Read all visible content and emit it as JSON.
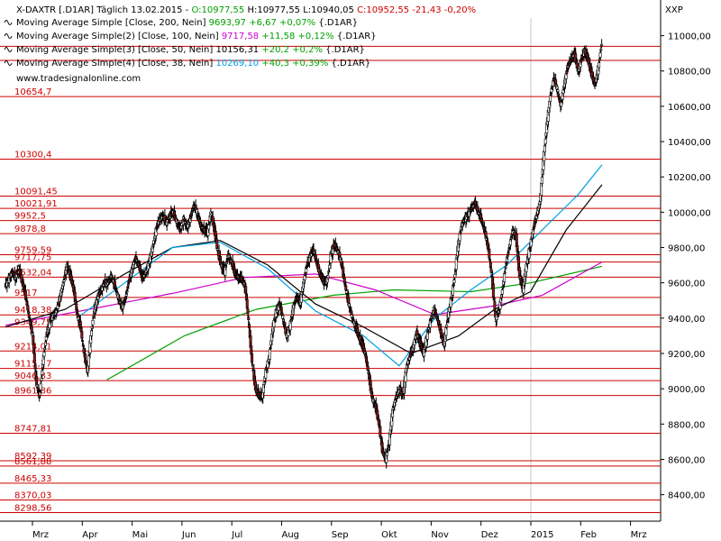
{
  "header": {
    "symbol_line": {
      "prefix": "X-DAXTR [.D1AR] Täglich 13.02.2015 - ",
      "open": "O:10977,55",
      "high": "H:10977,55",
      "low": "L:10940,05",
      "close": "C:10952,55 -21,43 -0,20%"
    },
    "currency": "XXP",
    "watermark": "www.tradesignalonline.com"
  },
  "legend": [
    {
      "label": "Moving Average Simple [Close, 200, Nein]",
      "value": "9693,97",
      "change": "+6,67 +0,07%",
      "suffix": "{.D1AR}",
      "color": "#00a000"
    },
    {
      "label": "Moving Average Simple(2) [Close, 100, Nein]",
      "value": "9717,58",
      "change": "+11,58 +0,12%",
      "suffix": "{.D1AR}",
      "color": "#cc00cc"
    },
    {
      "label": "Moving Average Simple(3) [Close, 50, Nein]",
      "value": "10156,31",
      "change": "+20,2 +0,2%",
      "suffix": "{.D1AR}",
      "color": "#000000"
    },
    {
      "label": "Moving Average Simple(4) [Close, 38, Nein]",
      "value": "10269,10",
      "change": "+40,3 +0,39%",
      "suffix": "{.D1AR}",
      "color": "#00a0e0"
    }
  ],
  "colors": {
    "candle": "#000000",
    "level_line": "#cc0000",
    "axis_text": "#000000",
    "grid": "#c8c8c8",
    "watermark": "#000000"
  },
  "chart_data": {
    "type": "candlestick",
    "y_axis": {
      "min": 8250,
      "max": 11100,
      "ticks": [
        "8400,00",
        "8600,00",
        "8800,00",
        "9000,00",
        "9200,00",
        "9400,00",
        "9600,00",
        "9800,00",
        "10000,00",
        "10200,00",
        "10400,00",
        "10600,00",
        "10800,00",
        "11000,00"
      ]
    },
    "x_axis": {
      "labels": [
        "Mrz",
        "Apr",
        "Mai",
        "Jun",
        "Jul",
        "Aug",
        "Sep",
        "Okt",
        "Nov",
        "Dez",
        "2015",
        "Feb",
        "Mrz"
      ]
    },
    "horizontal_levels": [
      {
        "value": 10940.0,
        "label": ""
      },
      {
        "value": 10860.0,
        "label": ""
      },
      {
        "value": 10654.7,
        "label": "10654,7"
      },
      {
        "value": 10300.4,
        "label": "10300,4"
      },
      {
        "value": 10091.45,
        "label": "10091,45"
      },
      {
        "value": 10021.91,
        "label": "10021,91"
      },
      {
        "value": 9952.5,
        "label": "9952,5"
      },
      {
        "value": 9878.8,
        "label": "9878,8"
      },
      {
        "value": 9759.59,
        "label": "9759,59"
      },
      {
        "value": 9717.75,
        "label": "9717,75"
      },
      {
        "value": 9632.04,
        "label": "9632,04"
      },
      {
        "value": 9517.0,
        "label": "9517"
      },
      {
        "value": 9418.38,
        "label": "9418,38"
      },
      {
        "value": 9349.75,
        "label": "9349,75"
      },
      {
        "value": 9214.01,
        "label": "9214,01"
      },
      {
        "value": 9115.17,
        "label": "9115,17"
      },
      {
        "value": 9046.33,
        "label": "9046,33"
      },
      {
        "value": 8961.86,
        "label": "8961,86"
      },
      {
        "value": 8747.81,
        "label": "8747,81"
      },
      {
        "value": 8592.39,
        "label": "8592,39"
      },
      {
        "value": 8561.88,
        "label": "8561,88"
      },
      {
        "value": 8465.33,
        "label": "8465,33"
      },
      {
        "value": 8370.03,
        "label": "8370,03"
      },
      {
        "value": 8298.56,
        "label": "8298,56"
      }
    ],
    "price_path": [
      [
        9580,
        9620,
        9660,
        9630,
        9680,
        9600,
        9520,
        9400,
        9300,
        9050,
        8950,
        9150,
        9300,
        9380,
        9420
      ],
      [
        9440,
        9520,
        9600,
        9700,
        9640,
        9560,
        9420,
        9350,
        9200,
        9100,
        9300,
        9450,
        9520,
        9560,
        9600
      ],
      [
        9600,
        9640,
        9580,
        9520,
        9460,
        9500,
        9600,
        9680,
        9740,
        9700,
        9620,
        9660,
        9720,
        9800,
        9900
      ],
      [
        9960,
        9980,
        9940,
        9980,
        10000,
        9950,
        9900,
        9960,
        9920,
        9960,
        10040,
        10000,
        9920,
        9900,
        9880
      ],
      [
        10000,
        9900,
        9780,
        9700,
        9660,
        9760,
        9720,
        9650,
        9630,
        9620,
        9580,
        9380,
        9150,
        9000,
        8960
      ],
      [
        8960,
        9100,
        9180,
        9340,
        9440,
        9480,
        9400,
        9300,
        9350,
        9460,
        9520,
        9480,
        9600,
        9700,
        9760
      ],
      [
        9780,
        9700,
        9640,
        9600,
        9620,
        9760,
        9820,
        9780,
        9720,
        9600,
        9500,
        9420,
        9360,
        9300,
        9250
      ],
      [
        9200,
        9080,
        8950,
        8900,
        8800,
        8650,
        8600,
        8700,
        8880,
        8950,
        9000,
        8960,
        9120,
        9180,
        9240
      ],
      [
        9320,
        9250,
        9200,
        9300,
        9380,
        9450,
        9400,
        9320,
        9250,
        9400,
        9500,
        9620,
        9800,
        9920,
        9960
      ],
      [
        9990,
        10020,
        10050,
        10000,
        9950,
        9880,
        9780,
        9620,
        9400,
        9440,
        9560,
        9700,
        9800,
        9900,
        9860
      ],
      [
        9640,
        9560,
        9700,
        9800,
        9900,
        9980,
        10060,
        10300,
        10500,
        10660,
        10760,
        10700,
        10600,
        10720,
        10820
      ],
      [
        10860,
        10900,
        10800,
        10860,
        10920,
        10860,
        10780,
        10720,
        10820,
        10960
      ]
    ],
    "series": [
      {
        "name": "Moving Average Simple [Close, 200, Nein]",
        "color": "#00a000",
        "anchors": [
          [
            0.17,
            9050
          ],
          [
            0.3,
            9300
          ],
          [
            0.42,
            9450
          ],
          [
            0.55,
            9530
          ],
          [
            0.65,
            9560
          ],
          [
            0.78,
            9550
          ],
          [
            0.88,
            9600
          ],
          [
            1.0,
            9694
          ]
        ]
      },
      {
        "name": "Moving Average Simple(2) [Close, 100, Nein]",
        "color": "#cc00cc",
        "anchors": [
          [
            0.0,
            9360
          ],
          [
            0.14,
            9450
          ],
          [
            0.28,
            9540
          ],
          [
            0.4,
            9630
          ],
          [
            0.52,
            9650
          ],
          [
            0.62,
            9560
          ],
          [
            0.72,
            9420
          ],
          [
            0.82,
            9470
          ],
          [
            0.9,
            9530
          ],
          [
            1.0,
            9718
          ]
        ]
      },
      {
        "name": "Moving Average Simple(3) [Close, 50, Nein]",
        "color": "#000000",
        "anchors": [
          [
            0.0,
            9350
          ],
          [
            0.1,
            9450
          ],
          [
            0.2,
            9650
          ],
          [
            0.28,
            9800
          ],
          [
            0.36,
            9840
          ],
          [
            0.44,
            9700
          ],
          [
            0.52,
            9480
          ],
          [
            0.6,
            9350
          ],
          [
            0.68,
            9200
          ],
          [
            0.76,
            9300
          ],
          [
            0.82,
            9450
          ],
          [
            0.88,
            9550
          ],
          [
            0.94,
            9900
          ],
          [
            1.0,
            10156
          ]
        ]
      },
      {
        "name": "Moving Average Simple(4) [Close, 38, Nein]",
        "color": "#00a0e0",
        "anchors": [
          [
            0.12,
            9400
          ],
          [
            0.2,
            9600
          ],
          [
            0.28,
            9800
          ],
          [
            0.36,
            9830
          ],
          [
            0.44,
            9680
          ],
          [
            0.52,
            9440
          ],
          [
            0.6,
            9300
          ],
          [
            0.66,
            9130
          ],
          [
            0.72,
            9400
          ],
          [
            0.78,
            9560
          ],
          [
            0.84,
            9700
          ],
          [
            0.9,
            9900
          ],
          [
            0.96,
            10100
          ],
          [
            1.0,
            10269
          ]
        ]
      }
    ]
  }
}
